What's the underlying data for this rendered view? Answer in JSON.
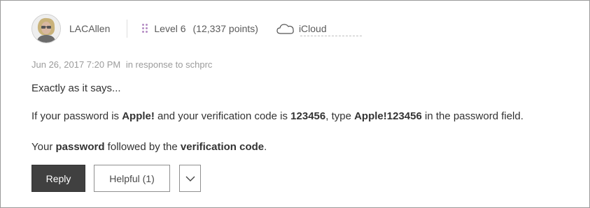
{
  "author": {
    "username": "LACAllen",
    "level": "Level 6",
    "points": "(12,337 points)",
    "community": "iCloud",
    "avatar_icon": "user-photo",
    "level_icon": "level-dots-icon",
    "community_icon": "cloud-icon",
    "accent_color": "#b58dc4"
  },
  "meta": {
    "timestamp": "Jun 26, 2017 7:20 PM",
    "in_response_to": "in response to schprc"
  },
  "body": {
    "p1": "Exactly as it says...",
    "p2": {
      "t1": "If your password is ",
      "b1": "Apple!",
      "t2": " and your verification code is ",
      "b2": "123456",
      "t3": ", type ",
      "b3": "Apple!123456",
      "t4": " in the password field."
    },
    "p3": {
      "t1": "Your ",
      "b1": "password",
      "t2": " followed by the ",
      "b2": "verification code",
      "t3": "."
    }
  },
  "actions": {
    "reply_label": "Reply",
    "helpful_label": "Helpful (1)",
    "more_icon": "chevron-down-icon",
    "reply_color": "#404040"
  }
}
